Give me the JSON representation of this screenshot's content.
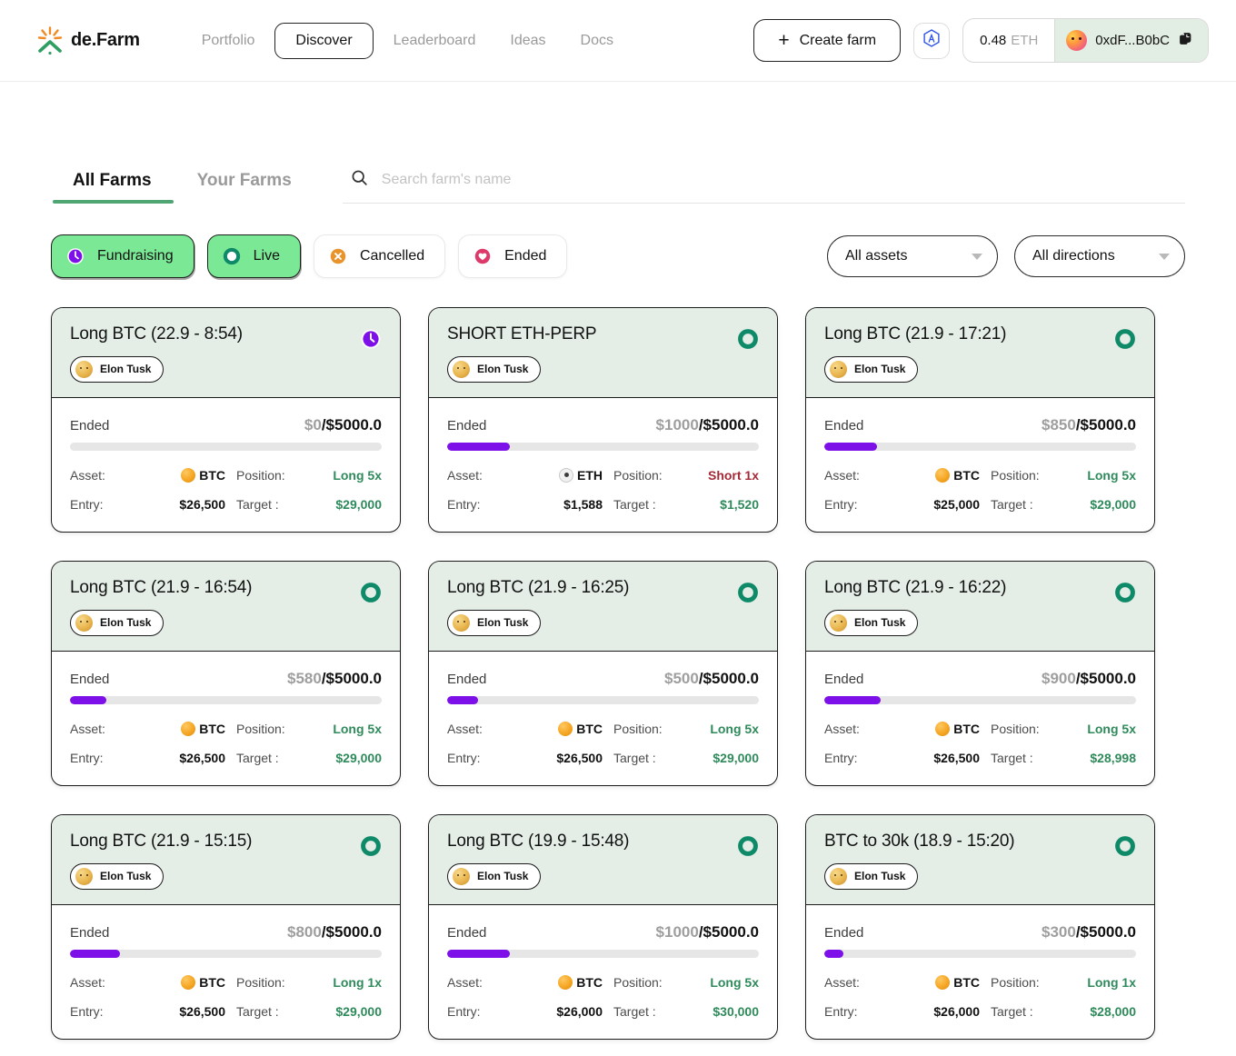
{
  "header": {
    "brand": "de.Farm",
    "nav": [
      {
        "label": "Portfolio",
        "active": false
      },
      {
        "label": "Discover",
        "active": true
      },
      {
        "label": "Leaderboard",
        "active": false
      },
      {
        "label": "Ideas",
        "active": false
      },
      {
        "label": "Docs",
        "active": false
      }
    ],
    "create_farm_label": "Create farm",
    "plus_glyph": "+",
    "balance_value": "0.48",
    "balance_unit": "ETH",
    "wallet_address": "0xdF...B0bC"
  },
  "tabs": [
    {
      "label": "All Farms",
      "active": true
    },
    {
      "label": "Your Farms",
      "active": false
    }
  ],
  "search": {
    "placeholder": "Search farm's name",
    "value": ""
  },
  "filters": {
    "chips": [
      {
        "label": "Fundraising",
        "icon": "clock-icon",
        "selected": true,
        "color": "#7d10e8"
      },
      {
        "label": "Live",
        "icon": "ring-icon",
        "selected": true,
        "color": "#0f8a68"
      },
      {
        "label": "Cancelled",
        "icon": "x-circle-icon",
        "selected": false,
        "color": "#e8932b"
      },
      {
        "label": "Ended",
        "icon": "heart-icon",
        "selected": false,
        "color": "#dd3a6b"
      }
    ],
    "assets_select": "All assets",
    "directions_select": "All directions"
  },
  "labels": {
    "fund_state": "Ended",
    "asset": "Asset:",
    "position": "Position:",
    "entry": "Entry:",
    "target": "Target :"
  },
  "cards": [
    {
      "title": "Long BTC (22.9 - 8:54)",
      "owner": "Elon Tusk",
      "status": "fundraising",
      "fund_state": "Ended",
      "raised": "$0",
      "goal": "$5000.0",
      "progress_pct": 0,
      "asset": "BTC",
      "asset_icon": "btc-coin-icon",
      "position": "Long 5x",
      "position_dir": "long",
      "entry": "$26,500",
      "target": "$29,000"
    },
    {
      "title": "SHORT ETH-PERP",
      "owner": "Elon Tusk",
      "status": "live",
      "fund_state": "Ended",
      "raised": "$1000",
      "goal": "$5000.0",
      "progress_pct": 20,
      "asset": "ETH",
      "asset_icon": "eth-coin-icon",
      "position": "Short 1x",
      "position_dir": "short",
      "entry": "$1,588",
      "target": "$1,520"
    },
    {
      "title": "Long BTC (21.9 - 17:21)",
      "owner": "Elon Tusk",
      "status": "live",
      "fund_state": "Ended",
      "raised": "$850",
      "goal": "$5000.0",
      "progress_pct": 17,
      "asset": "BTC",
      "asset_icon": "btc-coin-icon",
      "position": "Long 5x",
      "position_dir": "long",
      "entry": "$25,000",
      "target": "$29,000"
    },
    {
      "title": "Long BTC (21.9 - 16:54)",
      "owner": "Elon Tusk",
      "status": "live",
      "fund_state": "Ended",
      "raised": "$580",
      "goal": "$5000.0",
      "progress_pct": 11.6,
      "asset": "BTC",
      "asset_icon": "btc-coin-icon",
      "position": "Long 5x",
      "position_dir": "long",
      "entry": "$26,500",
      "target": "$29,000"
    },
    {
      "title": "Long BTC (21.9 - 16:25)",
      "owner": "Elon Tusk",
      "status": "live",
      "fund_state": "Ended",
      "raised": "$500",
      "goal": "$5000.0",
      "progress_pct": 10,
      "asset": "BTC",
      "asset_icon": "btc-coin-icon",
      "position": "Long 5x",
      "position_dir": "long",
      "entry": "$26,500",
      "target": "$29,000"
    },
    {
      "title": "Long BTC (21.9 - 16:22)",
      "owner": "Elon Tusk",
      "status": "live",
      "fund_state": "Ended",
      "raised": "$900",
      "goal": "$5000.0",
      "progress_pct": 18,
      "asset": "BTC",
      "asset_icon": "btc-coin-icon",
      "position": "Long 5x",
      "position_dir": "long",
      "entry": "$26,500",
      "target": "$28,998"
    },
    {
      "title": "Long BTC (21.9 - 15:15)",
      "owner": "Elon Tusk",
      "status": "live",
      "fund_state": "Ended",
      "raised": "$800",
      "goal": "$5000.0",
      "progress_pct": 16,
      "asset": "BTC",
      "asset_icon": "btc-coin-icon",
      "position": "Long 1x",
      "position_dir": "long",
      "entry": "$26,500",
      "target": "$29,000"
    },
    {
      "title": "Long BTC (19.9 - 15:48)",
      "owner": "Elon Tusk",
      "status": "live",
      "fund_state": "Ended",
      "raised": "$1000",
      "goal": "$5000.0",
      "progress_pct": 20,
      "asset": "BTC",
      "asset_icon": "btc-coin-icon",
      "position": "Long 5x",
      "position_dir": "long",
      "entry": "$26,000",
      "target": "$30,000"
    },
    {
      "title": "BTC to 30k (18.9 - 15:20)",
      "owner": "Elon Tusk",
      "status": "live",
      "fund_state": "Ended",
      "raised": "$300",
      "goal": "$5000.0",
      "progress_pct": 6,
      "asset": "BTC",
      "asset_icon": "btc-coin-icon",
      "position": "Long 1x",
      "position_dir": "long",
      "entry": "$26,000",
      "target": "$28,000"
    }
  ]
}
